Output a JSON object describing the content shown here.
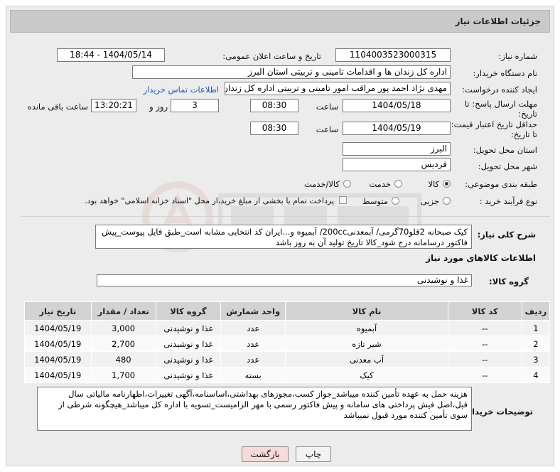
{
  "header": {
    "title": "جزئیات اطلاعات نیاز"
  },
  "need_number": {
    "label": "شماره نیاز:",
    "value": "1104003523000315"
  },
  "announce": {
    "label": "تاریخ و ساعت اعلان عمومی:",
    "value": "1404/05/14 - 18:44"
  },
  "buyer": {
    "label": "نام دستگاه خریدار:",
    "value": "اداره کل زندان ها و اقدامات تامینی و تربیتی استان البرز"
  },
  "requester": {
    "label": "ایجاد کننده درخواست:",
    "value": "مهدی نژاد احمد پور مراقب امور تامینی و تربیتی اداره کل زندان ها و اقدامات تامینی",
    "contact_link": "اطلاعات تماس خریدار"
  },
  "deadline": {
    "label_line1": "مهلت ارسال پاسخ: تا",
    "label_line2": "تاریخ:",
    "date": "1404/05/18",
    "time_label": "ساعت",
    "time": "08:30",
    "days": "3",
    "days_label": "روز و",
    "remaining": "13:20:21",
    "remaining_label": "ساعت باقی مانده"
  },
  "validity": {
    "label_line1": "حداقل تاریخ اعتبار قیمت:",
    "label_line2": "تا تاریخ:",
    "date": "1404/05/19",
    "time_label": "ساعت",
    "time": "08:30"
  },
  "province": {
    "label": "استان محل تحویل:",
    "value": "البرز"
  },
  "city": {
    "label": "شهر محل تحویل:",
    "value": "فردیس"
  },
  "category": {
    "label": "طبقه بندی موضوعی:",
    "options": [
      "کالا",
      "خدمت",
      "کالا/خدمت"
    ],
    "selected": "کالا"
  },
  "purchase_type": {
    "label": "نوع فرآیند خرید :",
    "options": [
      "جزیی",
      "متوسط"
    ],
    "note": "پرداخت تمام یا بخشی از مبلغ خرید،از محل \"اسناد خزانه اسلامی\" خواهد بود."
  },
  "summary": {
    "label": "شرح کلی نیاز:",
    "text": "کیک صبحانه 2قلو70گرمی/ آبمعدنی200cc/ آبمیوه و...ایران کد انتخابی مشابه است_طبق فایل پیوست_پیش فاکتور درسامانه درج شود_کالا تاریخ تولید آن به روز باشد"
  },
  "items_section": {
    "title": "اطلاعات کالاهای مورد نیاز"
  },
  "goods_group": {
    "label": "گروه کالا:",
    "value": "غذا و نوشیدنی"
  },
  "table": {
    "headers": [
      "ردیف",
      "کد کالا",
      "نام کالا",
      "واحد شمارش",
      "گروه کالا",
      "تعداد / مقدار",
      "تاریخ نیاز"
    ],
    "rows": [
      [
        "1",
        "--",
        "آبمیوه",
        "عدد",
        "غذا و نوشیدنی",
        "3,000",
        "1404/05/19"
      ],
      [
        "2",
        "--",
        "شیر تازه",
        "عدد",
        "غذا و نوشیدنی",
        "2,700",
        "1404/05/19"
      ],
      [
        "3",
        "--",
        "آب معدنی",
        "عدد",
        "غذا و نوشیدنی",
        "480",
        "1404/05/19"
      ],
      [
        "4",
        "--",
        "کیک",
        "بسته",
        "غذا و نوشیدنی",
        "1,700",
        "1404/05/19"
      ]
    ]
  },
  "buyer_notes": {
    "label": "توضیحات خریدار:",
    "text": "هزینه حمل به عهده تأمین کننده میباشد_جواز کسب،مجوزهای بهداشتی،اساسنامه،آگهی تغییرات،اظهارنامه مالیاتی سال قبل،اصل فیش پرداختی های سامانه و پیش فاکتور رسمی با مهر الزامیست_تسویه با اداره کل میباشد_هیچگونه شرطی از سوی تأمین کننده مورد قبول نمیباشد"
  },
  "buttons": {
    "print": "چاپ",
    "back": "بازگشت"
  },
  "colors": {
    "header_bg": "#c9c9c9",
    "link": "#1a58b5",
    "back_button": "#f7dada"
  }
}
